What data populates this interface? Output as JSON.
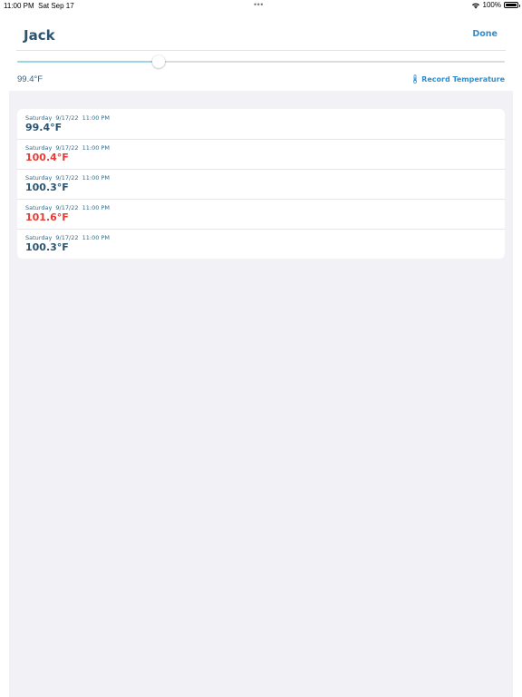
{
  "status_bar": {
    "time": "11:00 PM",
    "date": "Sat Sep 17",
    "center_dots": "•••",
    "battery_percent": "100%",
    "battery_level": 1.0,
    "icons": [
      "wifi-icon",
      "battery-icon"
    ]
  },
  "header": {
    "title": "Jack",
    "done_label": "Done"
  },
  "slider": {
    "fraction": 0.29,
    "value_text": "99.4°F"
  },
  "record": {
    "label": "Record Temperature",
    "icon": "thermometer-icon"
  },
  "colors": {
    "normal": "#2a5470",
    "fever": "#e63c33",
    "accent": "#2f8fce"
  },
  "readings": [
    {
      "date": "Saturday  9/17/22  11:00 PM",
      "temp": "99.4°F",
      "fever": false
    },
    {
      "date": "Saturday  9/17/22  11:00 PM",
      "temp": "100.4°F",
      "fever": true
    },
    {
      "date": "Saturday  9/17/22  11:00 PM",
      "temp": "100.3°F",
      "fever": false
    },
    {
      "date": "Saturday  9/17/22  11:00 PM",
      "temp": "101.6°F",
      "fever": true
    },
    {
      "date": "Saturday  9/17/22  11:00 PM",
      "temp": "100.3°F",
      "fever": false
    }
  ]
}
